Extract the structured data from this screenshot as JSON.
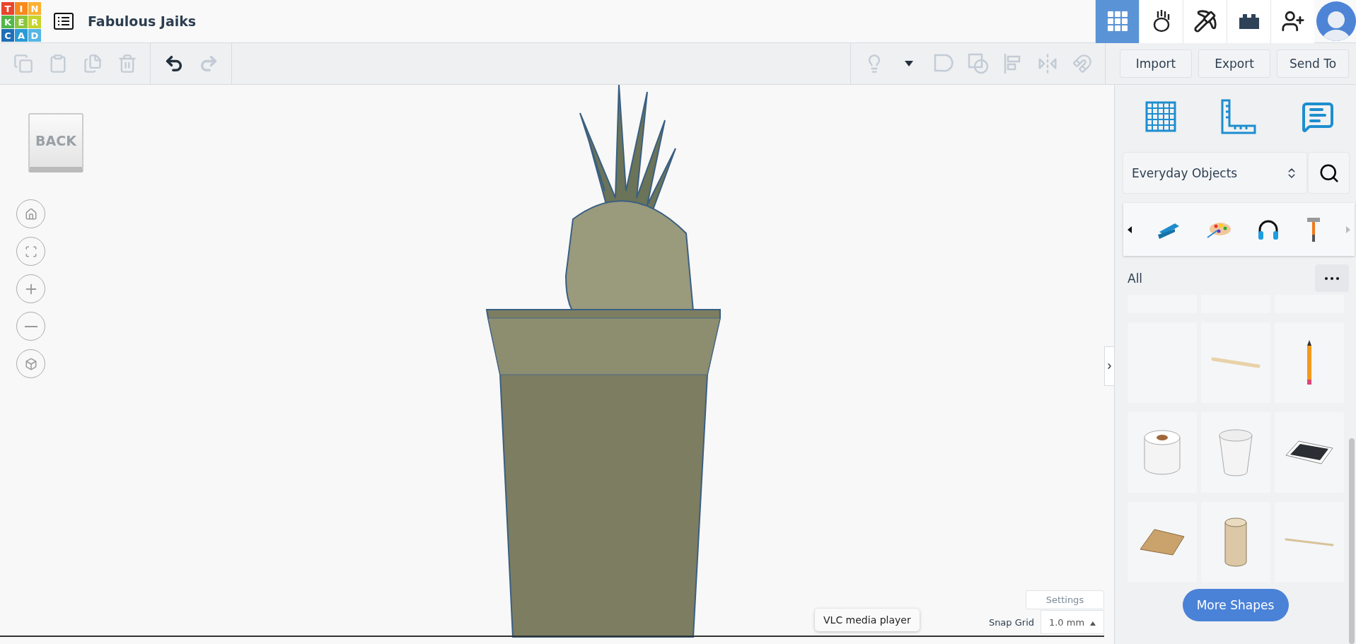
{
  "logo": {
    "letters": [
      "T",
      "I",
      "N",
      "K",
      "E",
      "R",
      "C",
      "A",
      "D"
    ]
  },
  "design_title": "Fabulous Jaiks",
  "nav_tabs": [
    {
      "selected": true
    },
    {
      "selected": false
    },
    {
      "selected": false
    },
    {
      "selected": false
    }
  ],
  "edit_tools": [
    {
      "disabled": true
    },
    {
      "disabled": true
    },
    {
      "disabled": true
    },
    {
      "disabled": true
    }
  ],
  "history_tools": [
    {
      "disabled": false
    },
    {
      "disabled": true
    }
  ],
  "shape_tools": [
    {
      "disabled": true
    },
    {
      "disabled": false
    },
    {
      "disabled": true
    },
    {
      "disabled": true
    },
    {
      "disabled": true
    },
    {
      "disabled": true
    }
  ],
  "actions": [
    "Import",
    "Export",
    "Send To"
  ],
  "viewport": {
    "back_label": "BACK",
    "settings": "Settings",
    "snap_grid": {
      "label": "Snap Grid",
      "value": "1.0 mm"
    },
    "tooltip": "VLC media player"
  },
  "library": {
    "category": "Everyday Objects",
    "filter": "All",
    "more_button": "More Shapes"
  }
}
